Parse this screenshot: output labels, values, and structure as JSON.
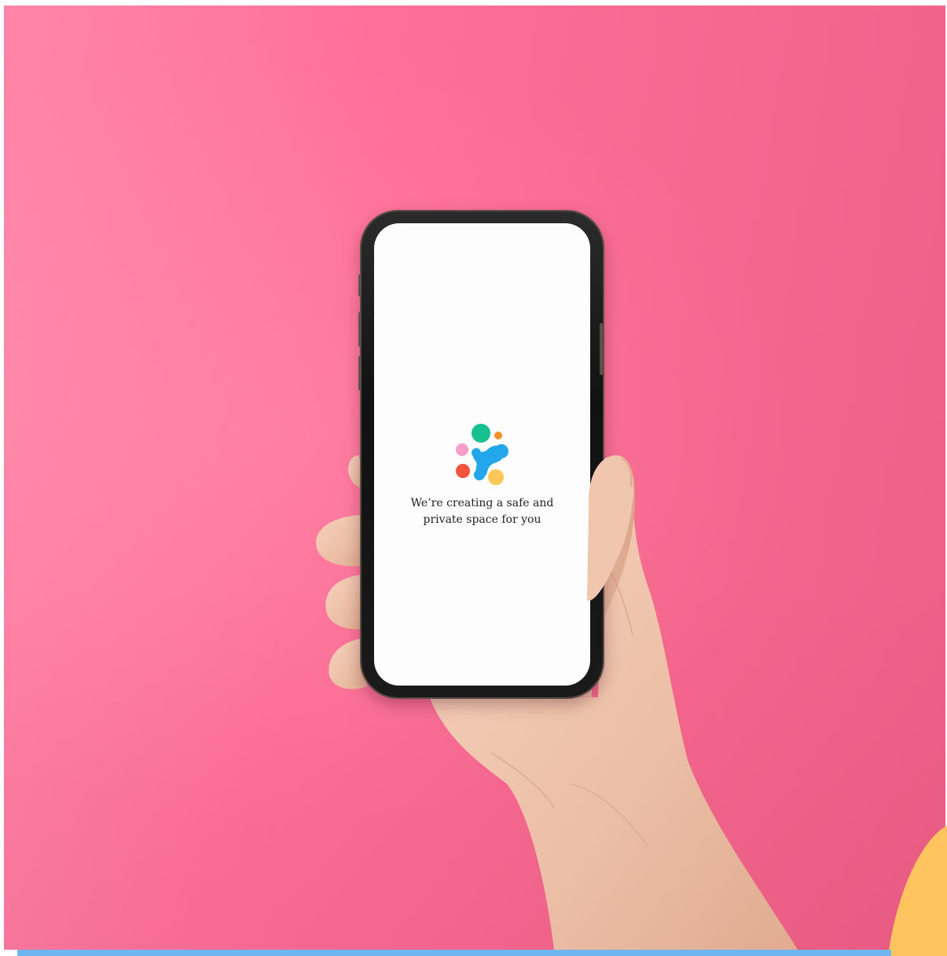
{
  "photo": {
    "background_color": "#ff6f98",
    "subject": "hand holding smartphone"
  },
  "phone": {
    "screen": {
      "logo_icon": "molecule-dots-logo-icon",
      "message_line_1": "We’re creating a safe and",
      "message_line_2": "private space for you"
    }
  },
  "decor": {
    "bottom_bar_color": "#6fb5ef",
    "corner_blob_color": "#ffc460"
  }
}
